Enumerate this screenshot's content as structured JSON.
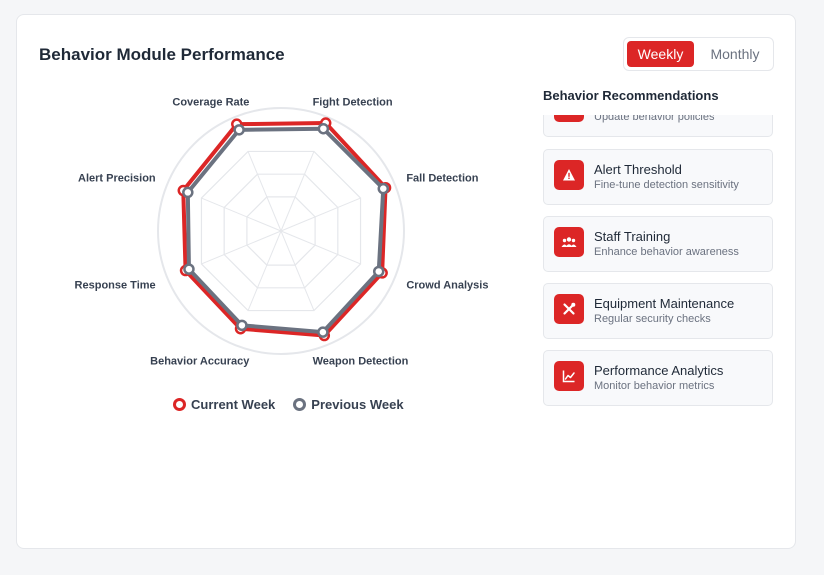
{
  "title": "Behavior Module Performance",
  "toggle": {
    "weekly": "Weekly",
    "monthly": "Monthly",
    "active": "weekly"
  },
  "colors": {
    "accent": "#dc2626",
    "previous": "#6b7280"
  },
  "chart_data": {
    "type": "radar",
    "categories": [
      "Fight Detection",
      "Fall Detection",
      "Crowd Analysis",
      "Weapon Detection",
      "Behavior Accuracy",
      "Response Time",
      "Alert Precision",
      "Coverage Rate"
    ],
    "max": 100,
    "series": [
      {
        "name": "Current Week",
        "values": [
          95,
          92,
          89,
          92,
          86,
          84,
          86,
          94
        ],
        "color": "#dc2626"
      },
      {
        "name": "Previous Week",
        "values": [
          90,
          90,
          86,
          89,
          83,
          81,
          82,
          89
        ],
        "color": "#6b7280"
      }
    ]
  },
  "recommendations": {
    "title": "Behavior Recommendations",
    "items": [
      {
        "name": "",
        "desc": "Update behavior policies",
        "icon": "policy-icon"
      },
      {
        "name": "Alert Threshold",
        "desc": "Fine-tune detection sensitivity",
        "icon": "warning-icon"
      },
      {
        "name": "Staff Training",
        "desc": "Enhance behavior awareness",
        "icon": "users-icon"
      },
      {
        "name": "Equipment Maintenance",
        "desc": "Regular security checks",
        "icon": "tools-icon"
      },
      {
        "name": "Performance Analytics",
        "desc": "Monitor behavior metrics",
        "icon": "chart-line-icon"
      }
    ]
  }
}
